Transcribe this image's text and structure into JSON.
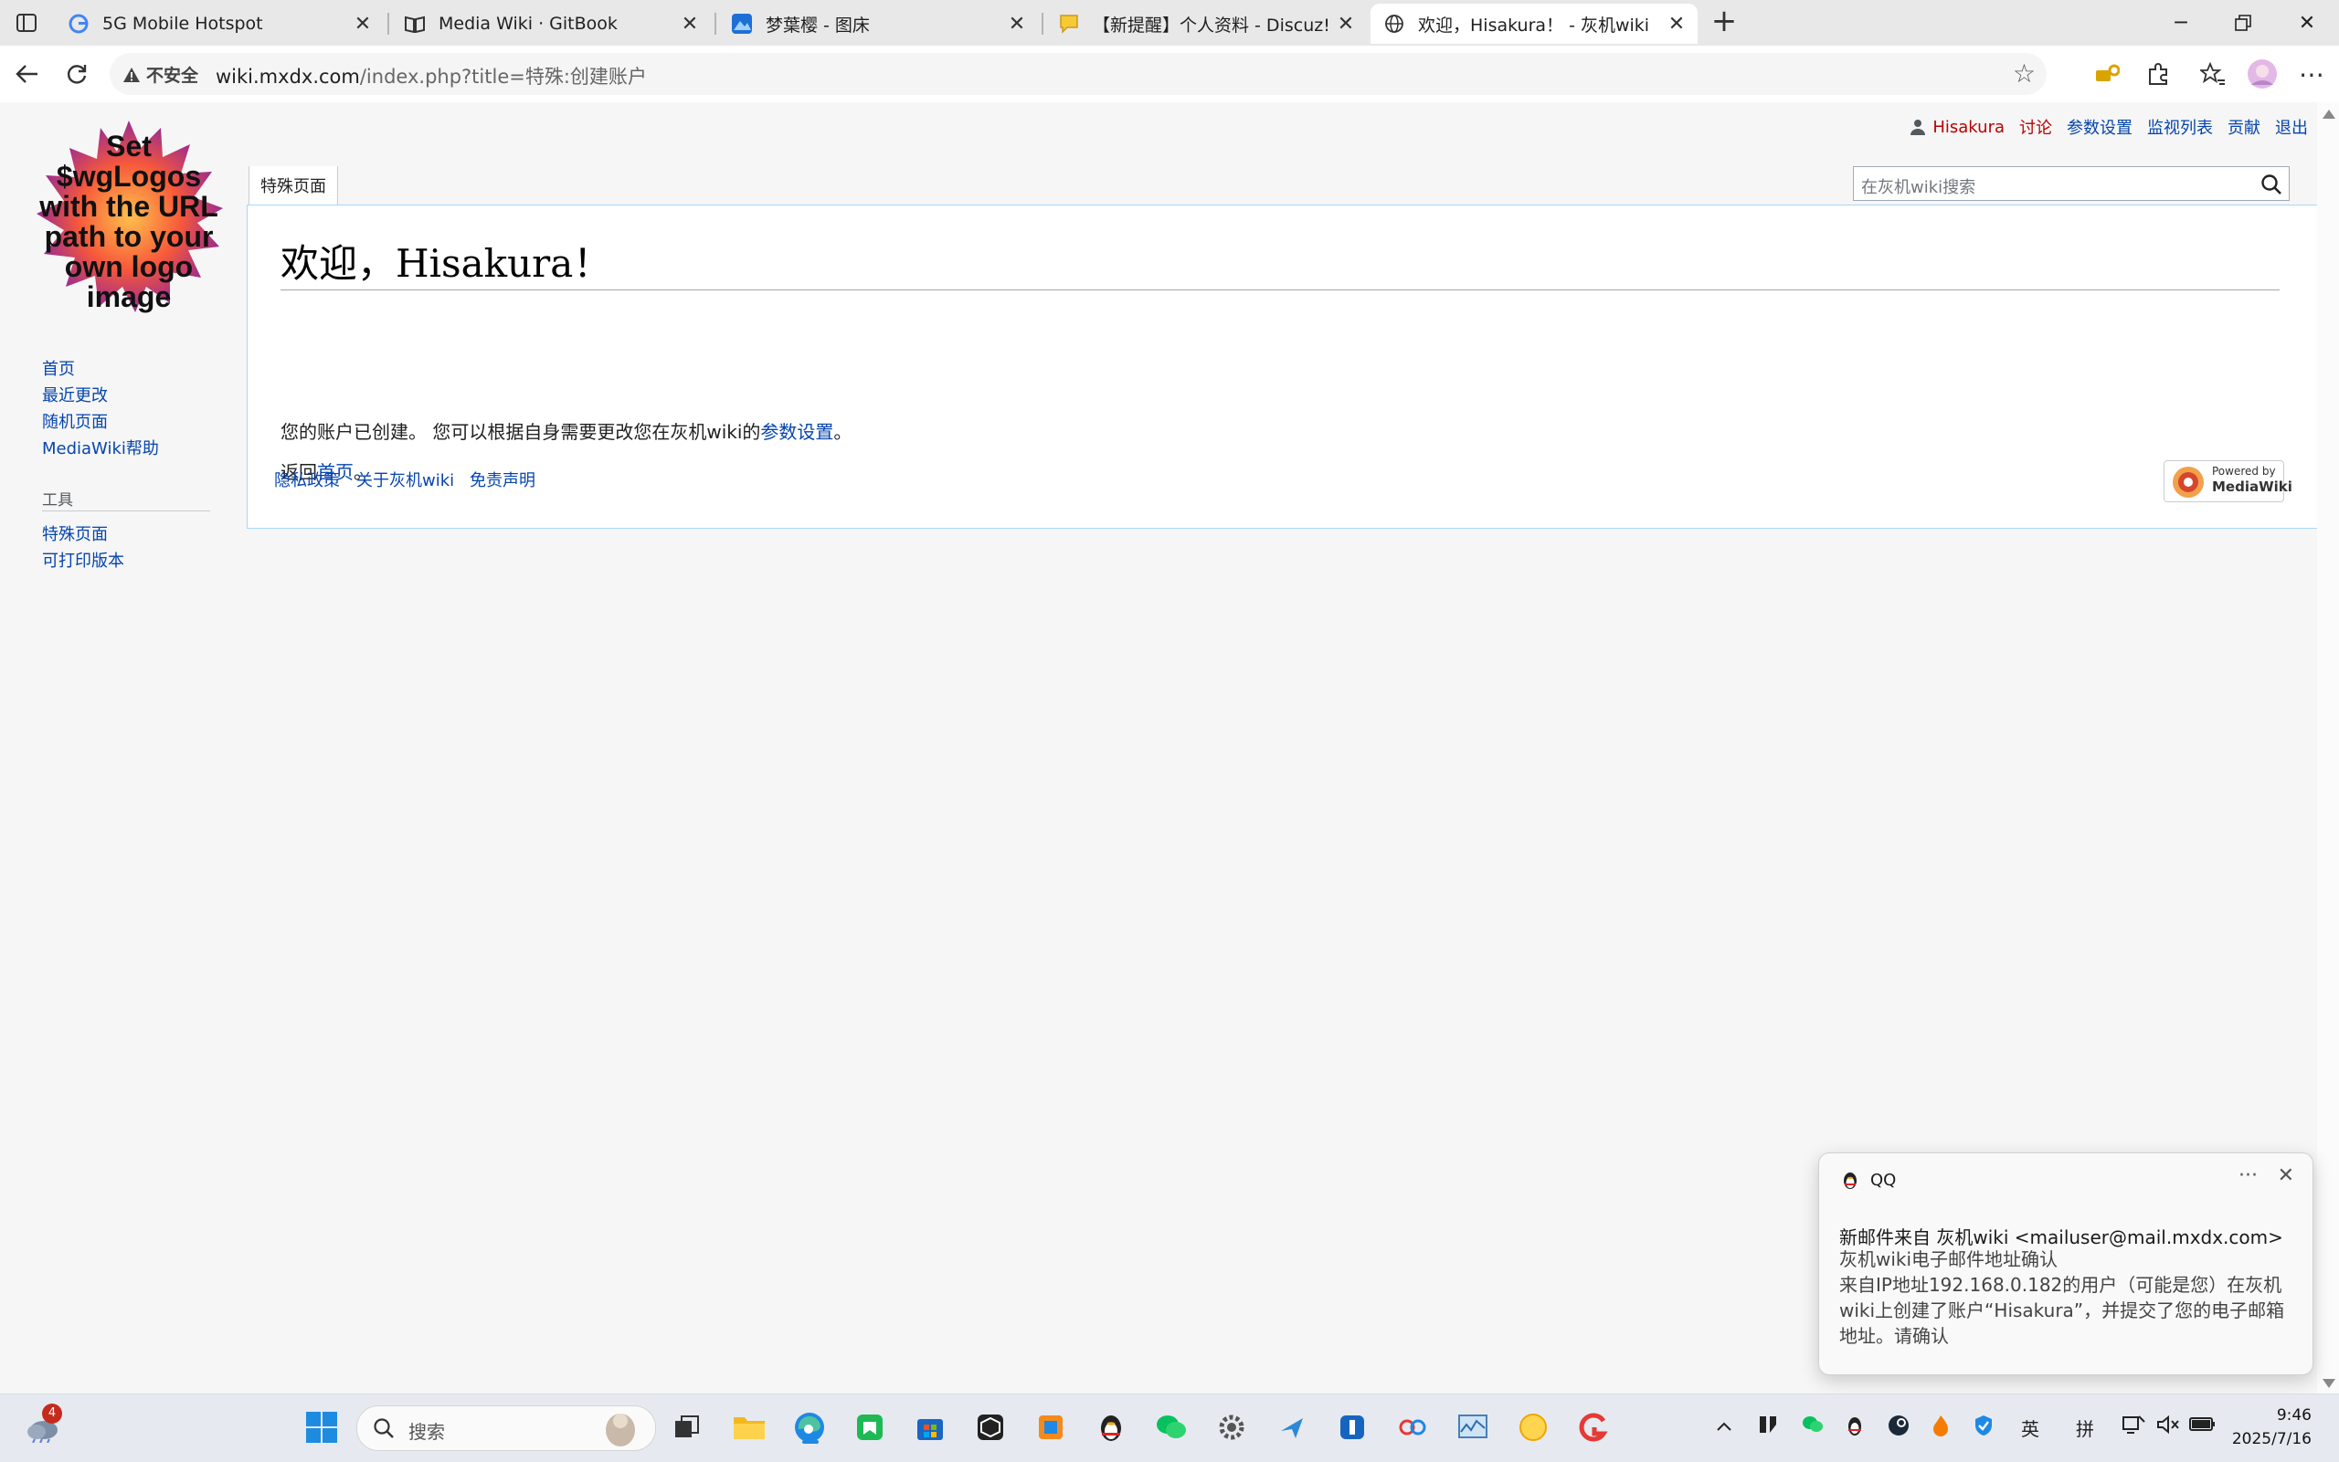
{
  "browser": {
    "tabs": [
      {
        "title": "5G Mobile Hotspot"
      },
      {
        "title": "Media Wiki · GitBook"
      },
      {
        "title": "梦葉樱 - 图床"
      },
      {
        "title": "【新提醒】个人资料 - Discuz! Board"
      },
      {
        "title": "欢迎，Hisakura！ - 灰机wiki",
        "active": true
      }
    ],
    "security_label": "不安全",
    "url_host": "wiki.mxdx.com",
    "url_rest": "/index.php?title=特殊:创建账户"
  },
  "wiki": {
    "logo_text": [
      "Set",
      "$wgLogos",
      "with the URL",
      "path to your",
      "own logo",
      "image"
    ],
    "personal": {
      "user": "Hisakura",
      "talk": "讨论",
      "prefs": "参数设置",
      "watchlist": "监视列表",
      "contribs": "贡献",
      "logout": "退出"
    },
    "namespace_tab": "特殊页面",
    "search_placeholder": "在灰机wiki搜索",
    "nav": [
      "首页",
      "最近更改",
      "随机页面",
      "MediaWiki帮助"
    ],
    "tools_heading": "工具",
    "tools": [
      "特殊页面",
      "可打印版本"
    ],
    "heading": "欢迎，Hisakura！",
    "line1_prefix": "您的账户已创建。 您可以根据自身需要更改您在灰机wiki的",
    "line1_link": "参数设置",
    "line1_suffix": "。",
    "line2_prefix": "返回",
    "line2_link": "首页",
    "line2_suffix": "。",
    "footer": [
      "隐私政策",
      "关于灰机wiki",
      "免责声明"
    ],
    "powered_line1": "Powered by",
    "powered_line2": "MediaWiki"
  },
  "notification": {
    "app": "QQ",
    "title": "新邮件来自 灰机wiki <mailuser@mail.mxdx.com>",
    "subject": "灰机wiki电子邮件地址确认",
    "body": "来自IP地址192.168.0.182的用户（可能是您）在灰机wiki上创建了账户“Hisakura”，并提交了您的电子邮箱地址。请确认"
  },
  "taskbar": {
    "search_label": "搜索",
    "weather_badge": "4",
    "ime1": "英",
    "ime2": "拼",
    "time": "9:46",
    "date": "2025/7/16"
  }
}
